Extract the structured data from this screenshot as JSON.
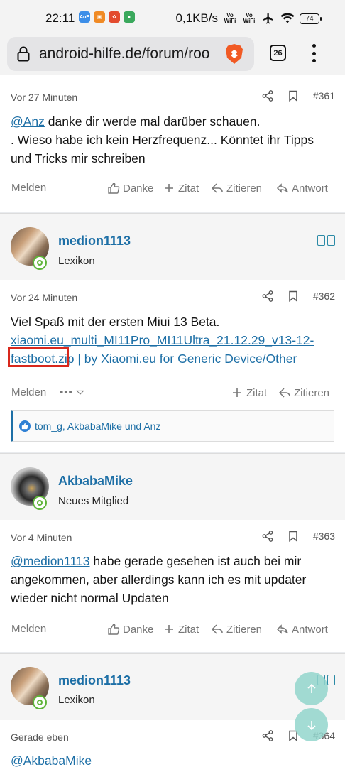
{
  "status_bar": {
    "time": "22:11",
    "net_speed": "0,1KB/s",
    "volte1": "Vo WiFi",
    "volte2": "Vo WiFi",
    "battery": "74"
  },
  "browser": {
    "url": "android-hilfe.de/forum/roo",
    "tab_count": "26"
  },
  "common": {
    "report": "Melden",
    "like": "Danke",
    "quote_add": "Zitat",
    "quote": "Zitieren",
    "reply": "Antwort"
  },
  "posts": [
    {
      "time": "Vor 27 Minuten",
      "number": "#361",
      "mention": "@Anz",
      "text1": " danke dir werde mal darüber schauen.",
      "text2": ". Wieso habe ich kein Herzfrequenz... Könntet ihr Tipps und Tricks mir schreiben"
    },
    {
      "user": "medion1113",
      "role": "Lexikon",
      "time": "Vor 24 Minuten",
      "number": "#362",
      "text": "Viel Spaß mit der ersten Miui 13 Beta.",
      "link": "xiaomi.eu_multi_MI11Pro_MI11Ultra_21.12.29_v13-12-fastboot.zip | by Xiaomi.eu for Generic Device/Other",
      "more": "•••",
      "reactions": "tom_g, AkbabaMike und Anz"
    },
    {
      "user": "AkbabaMike",
      "role": "Neues Mitglied",
      "time": "Vor 4 Minuten",
      "number": "#363",
      "mention": "@medion1113",
      "text": " habe gerade gesehen ist auch bei mir angekommen, aber allerdings kann ich es mit updater wieder nicht normal Updaten"
    },
    {
      "user": "medion1113",
      "role": "Lexikon",
      "time": "Gerade eben",
      "number": "#364",
      "mention": "@AkbabaMike"
    }
  ],
  "colors": {
    "link": "#1d6fa6",
    "highlight": "#d8281c",
    "online": "#5fb43a",
    "fab": "#93d6cd"
  }
}
